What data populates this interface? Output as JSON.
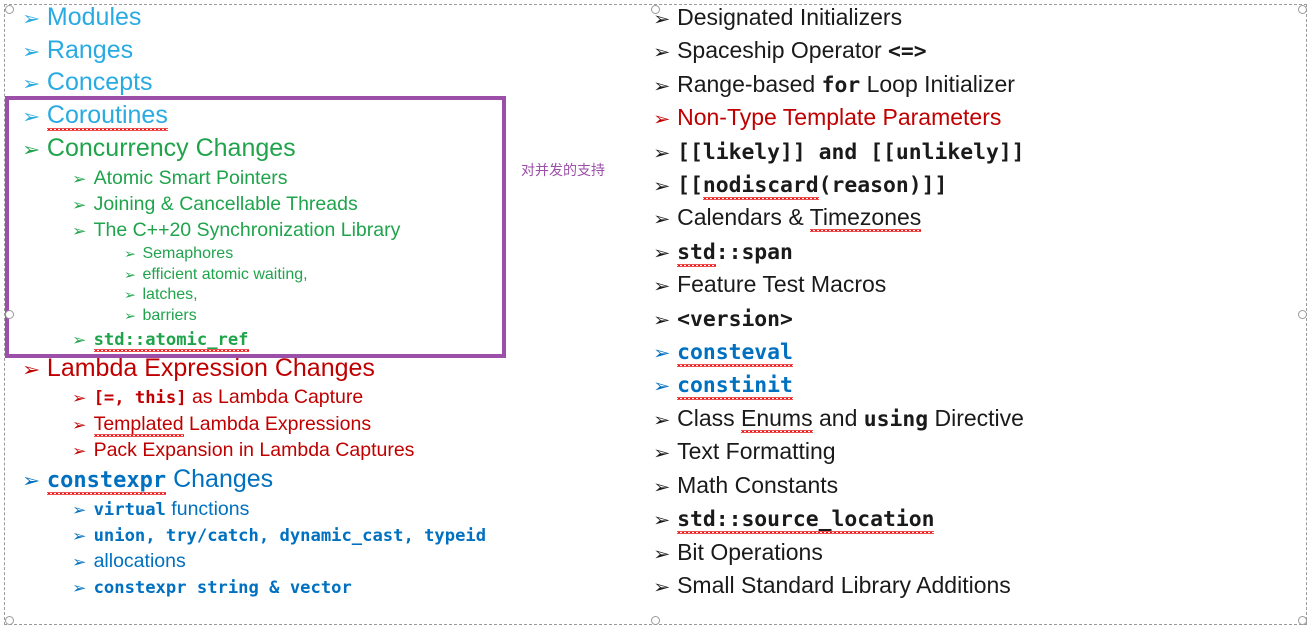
{
  "slide": {
    "annotation_note": "对并发的支持",
    "highlight_color": "#9B4FA8",
    "colors": {
      "cyan": "#29ABE2",
      "green": "#1FA44C",
      "red": "#C00000",
      "blue": "#0070C0",
      "black": "#1A1A1A",
      "purple": "#9B4FA8"
    }
  },
  "left_column": {
    "items": [
      {
        "level": 1,
        "color": "cyan",
        "text": "Modules"
      },
      {
        "level": 1,
        "color": "cyan",
        "text": "Ranges"
      },
      {
        "level": 1,
        "color": "cyan",
        "text": "Concepts"
      },
      {
        "level": 1,
        "color": "cyan",
        "text": "Coroutines",
        "spellcheck": true
      },
      {
        "level": 1,
        "color": "green",
        "text": "Concurrency Changes"
      },
      {
        "level": 2,
        "color": "green",
        "text": "Atomic Smart Pointers"
      },
      {
        "level": 2,
        "color": "green",
        "text": "Joining & Cancellable Threads"
      },
      {
        "level": 2,
        "color": "green",
        "text": "The C++20 Synchronization Library"
      },
      {
        "level": 3,
        "color": "green",
        "text": "Semaphores"
      },
      {
        "level": 3,
        "color": "green",
        "text": "efficient atomic waiting,"
      },
      {
        "level": 3,
        "color": "green",
        "text": "latches,"
      },
      {
        "level": 3,
        "color": "green",
        "text": "barriers"
      },
      {
        "level": 2,
        "color": "green",
        "text": "std::atomic_ref",
        "mono": true,
        "spellcheck": true
      },
      {
        "level": 1,
        "color": "red",
        "text": "Lambda Expression Changes"
      },
      {
        "level": 2,
        "color": "red",
        "text": "[=, this] as Lambda Capture",
        "mono_prefix": "[=, this]"
      },
      {
        "level": 2,
        "color": "red",
        "text": "Templated Lambda Expressions",
        "spellcheck_word": "Templated"
      },
      {
        "level": 2,
        "color": "red",
        "text": "Pack Expansion in Lambda Captures"
      },
      {
        "level": 1,
        "color": "blue",
        "text": "constexpr Changes",
        "mono_prefix": "constexpr",
        "spellcheck_word": "constexpr"
      },
      {
        "level": 2,
        "color": "blue",
        "text": "virtual functions",
        "mono_prefix": "virtual"
      },
      {
        "level": 2,
        "color": "blue",
        "text": "union, try/catch, dynamic_cast, typeid",
        "mono": true
      },
      {
        "level": 2,
        "color": "blue",
        "text": "allocations"
      },
      {
        "level": 2,
        "color": "blue",
        "text": "constexpr string & vector",
        "mono": true
      }
    ]
  },
  "right_column": {
    "items": [
      {
        "color": "black",
        "text": "Designated Initializers"
      },
      {
        "color": "black",
        "text": "Spaceship Operator <=>",
        "mono_suffix": "<=>"
      },
      {
        "color": "black",
        "text": "Range-based for Loop Initializer",
        "mono_word": "for"
      },
      {
        "color": "red",
        "text": "Non-Type Template Parameters"
      },
      {
        "color": "black",
        "text": "[[likely]] and [[unlikely]]",
        "mono": true
      },
      {
        "color": "black",
        "text": "[[nodiscard(reason)]]",
        "mono": true,
        "spellcheck_word": "nodiscard"
      },
      {
        "color": "black",
        "text": "Calendars & Timezones",
        "spellcheck_word": "Timezones"
      },
      {
        "color": "black",
        "text": "std::span",
        "mono": true,
        "spellcheck_word": "std"
      },
      {
        "color": "black",
        "text": "Feature Test Macros"
      },
      {
        "color": "black",
        "text": "<version>",
        "mono": true
      },
      {
        "color": "blue",
        "text": "consteval",
        "mono": true,
        "spellcheck": true
      },
      {
        "color": "blue",
        "text": "constinit",
        "mono": true,
        "spellcheck": true
      },
      {
        "color": "black",
        "text": "Class Enums and using Directive",
        "mono_word": "using",
        "spellcheck_word": "Enums"
      },
      {
        "color": "black",
        "text": "Text Formatting"
      },
      {
        "color": "black",
        "text": "Math Constants"
      },
      {
        "color": "black",
        "text": "std::source_location",
        "mono": true,
        "spellcheck": true
      },
      {
        "color": "black",
        "text": "Bit Operations"
      },
      {
        "color": "black",
        "text": "Small Standard Library Additions"
      }
    ]
  },
  "markers": {
    "bullet_glyph": "➢"
  }
}
